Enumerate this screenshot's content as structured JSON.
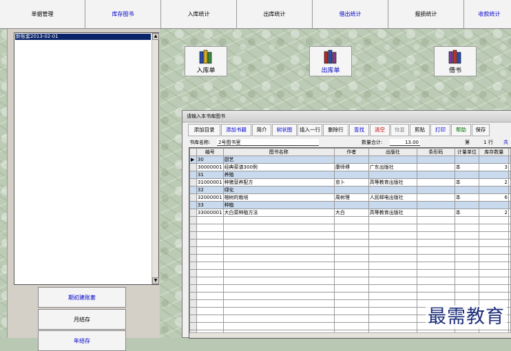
{
  "nav": {
    "tabs": [
      {
        "label": "单据管理",
        "color": "#000000"
      },
      {
        "label": "库存图书",
        "color": "#0000cc"
      },
      {
        "label": "入库统计",
        "color": "#000000"
      },
      {
        "label": "出库统计",
        "color": "#000000"
      },
      {
        "label": "借出统计",
        "color": "#0000cc"
      },
      {
        "label": "报损统计",
        "color": "#000000"
      },
      {
        "label": "收款统计",
        "color": "#0000cc"
      }
    ]
  },
  "sidebar": {
    "selected_item": "新账套2013-02-01",
    "buttons": {
      "init_account": "期初建账套",
      "month_end": "月结存",
      "third": "年结存"
    }
  },
  "actions": {
    "inbound": "入库单",
    "outbound": "出库单",
    "borrow": "借书"
  },
  "panel": {
    "title": "请输入本书库图书",
    "toolbar": [
      {
        "label": "添加目录",
        "color": "#000000"
      },
      {
        "label": "添加书籍",
        "color": "#0000cc"
      },
      {
        "label": "简介",
        "color": "#000000"
      },
      {
        "label": "树状图",
        "color": "#0000cc"
      },
      {
        "label": "插入一行",
        "color": "#000000"
      },
      {
        "label": "删除行",
        "color": "#000000"
      },
      {
        "label": "查找",
        "color": "#0000cc"
      },
      {
        "label": "清空",
        "color": "#c00000"
      },
      {
        "label": "恢复",
        "color": "#888888"
      },
      {
        "label": "剪贴",
        "color": "#000000"
      },
      {
        "label": "打印",
        "color": "#0000cc"
      },
      {
        "label": "帮助",
        "color": "#007000"
      },
      {
        "label": "保存",
        "color": "#000000"
      }
    ],
    "library_label": "书库名称:",
    "library_value": "2号图书室",
    "qty_label": "数量合计:",
    "qty_value": "13.00",
    "page_label": "第",
    "page_value": "1",
    "row_label": "行",
    "total_label": "共"
  },
  "table": {
    "columns": [
      "编号",
      "图书名称",
      "作者",
      "出版社",
      "条形码",
      "计量单位",
      "库存数量"
    ],
    "rows": [
      {
        "cat": true,
        "code": "30",
        "name": "厨艺",
        "author": "",
        "publisher": "",
        "barcode": "",
        "unit": "",
        "qty": ""
      },
      {
        "cat": false,
        "code": "30000001",
        "name": "经典菜谱300例",
        "author": "康师傅",
        "publisher": "广东出版社",
        "barcode": "",
        "unit": "本",
        "qty": "3"
      },
      {
        "cat": true,
        "code": "31",
        "name": "养殖",
        "author": "",
        "publisher": "",
        "barcode": "",
        "unit": "",
        "qty": ""
      },
      {
        "cat": false,
        "code": "31000001",
        "name": "种猪营养配方",
        "author": "京卜",
        "publisher": "高等教育出版社",
        "barcode": "",
        "unit": "本",
        "qty": "2"
      },
      {
        "cat": true,
        "code": "32",
        "name": "绿化",
        "author": "",
        "publisher": "",
        "barcode": "",
        "unit": "",
        "qty": ""
      },
      {
        "cat": false,
        "code": "32000001",
        "name": "榕树的栽培",
        "author": "周树理",
        "publisher": "人民邮电出版社",
        "barcode": "",
        "unit": "本",
        "qty": "6"
      },
      {
        "cat": true,
        "code": "33",
        "name": "种植",
        "author": "",
        "publisher": "",
        "barcode": "",
        "unit": "",
        "qty": ""
      },
      {
        "cat": false,
        "code": "33000001",
        "name": "大白菜种植方法",
        "author": "大白",
        "publisher": "高等教育出版社",
        "barcode": "",
        "unit": "本",
        "qty": "2"
      }
    ],
    "empty_rows": 16
  },
  "watermark": "最需教育"
}
